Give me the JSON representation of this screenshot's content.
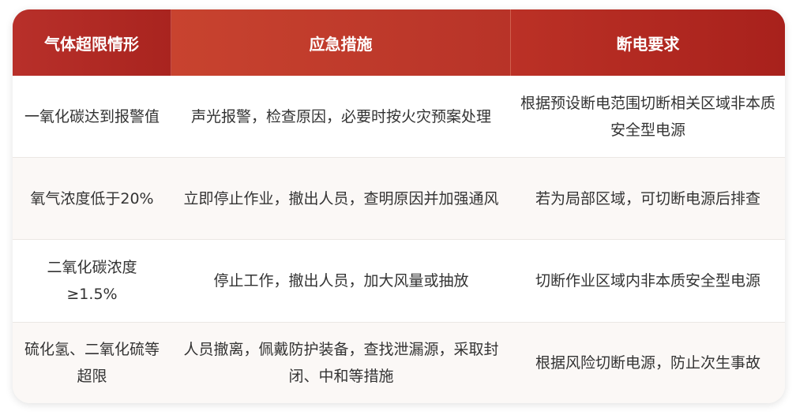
{
  "table": {
    "headers": [
      "气体超限情形",
      "应急措施",
      "断电要求"
    ],
    "rows": [
      {
        "situation": "一氧化碳达到报警值",
        "measure": "声光报警，检查原因，必要时按火灾预案处理",
        "power": "根据预设断电范围切断相关区域非本质安全型电源"
      },
      {
        "situation": "氧气浓度低于20%",
        "measure": "立即停止作业，撤出人员，查明原因并加强通风",
        "power": "若为局部区域，可切断电源后排查"
      },
      {
        "situation": "二氧化碳浓度≥1.5%",
        "measure": "停止工作，撤出人员，加大风量或抽放",
        "power": "切断作业区域内非本质安全型电源"
      },
      {
        "situation": "硫化氢、二氧化硫等超限",
        "measure": "人员撤离，佩戴防护装备，查找泄漏源，采取封闭、中和等措施",
        "power": "根据风险切断电源，防止次生事故"
      }
    ]
  },
  "colors": {
    "header_red": "#b52a22",
    "text": "#333333",
    "row_alt": "#fbf8f6"
  }
}
